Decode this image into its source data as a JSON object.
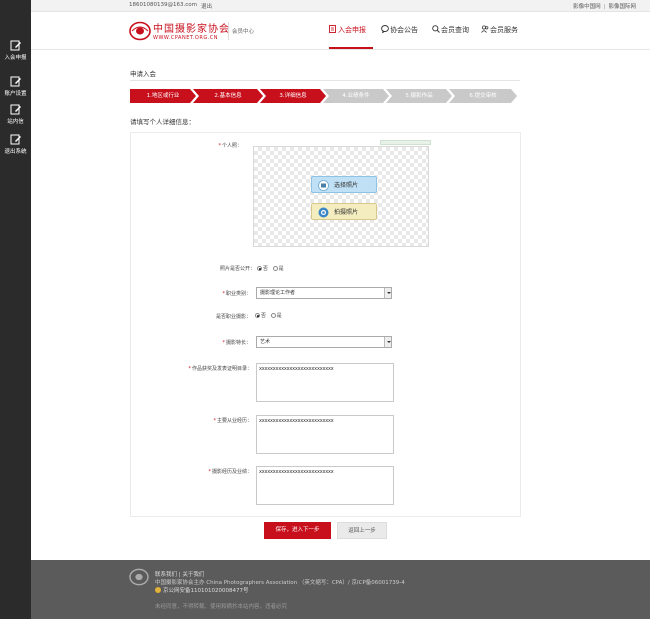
{
  "sidebar": {
    "items": [
      {
        "label": "入会申报",
        "icon": "edit-doc-icon"
      },
      {
        "label": "账户设置",
        "icon": "edit-doc-icon"
      },
      {
        "label": "站内信",
        "icon": "edit-doc-icon"
      },
      {
        "label": "退出系统",
        "icon": "edit-doc-icon"
      }
    ]
  },
  "topbar": {
    "email": "18601080139@163.com",
    "logout": "退出",
    "link1": "影像中国网",
    "separator": "|",
    "link2": "影像国际网"
  },
  "header": {
    "logo_cn": "中国摄影家协会",
    "logo_en": "WWW.CPANET.ORG.CN",
    "member_center": "会员中心",
    "nav": [
      {
        "label": "入会申报",
        "icon": "doc-edit-icon",
        "active": true
      },
      {
        "label": "协会公告",
        "icon": "chat-bubble-icon",
        "active": false
      },
      {
        "label": "会员查询",
        "icon": "search-icon",
        "active": false
      },
      {
        "label": "会员服务",
        "icon": "users-icon",
        "active": false
      }
    ]
  },
  "main": {
    "page_title": "申请入会",
    "steps": [
      {
        "label": "1.地区或行业",
        "state": "done"
      },
      {
        "label": "2.基本信息",
        "state": "done"
      },
      {
        "label": "3.详细信息",
        "state": "current"
      },
      {
        "label": "4.业绩条件",
        "state": "todo"
      },
      {
        "label": "5.摄影作品",
        "state": "todo"
      },
      {
        "label": "6.提交审核",
        "state": "todo"
      }
    ],
    "section_label": "请填写个人详细信息："
  },
  "form": {
    "req_mark": "*",
    "photo_label": "个人照：",
    "select_photo": "选择照片",
    "take_photo": "拍摄照片",
    "photo_public_label": "照片是否公开：",
    "radio_no": "否",
    "radio_yes": "是",
    "occupation_label": "职业类别：",
    "occupation_value": "摄影理论工作者",
    "pro_photo_label": "是否职业摄影：",
    "specialty_label": "摄影特长：",
    "specialty_value": "艺术",
    "awards_label": "作品获奖及发表证明目录：",
    "awards_value": "xxxxxxxxxxxxxxxxxxxxxxxxxxx",
    "career_label": "主要从业经历：",
    "career_value": "xxxxxxxxxxxxxxxxxxxxxxxxxxx",
    "photo_exp_label": "摄影经历及业绩：",
    "photo_exp_value": "xxxxxxxxxxxxxxxxxxxxxxxxxxx",
    "save_button": "保存，进入下一步",
    "prev_button": "返回上一步"
  },
  "footer": {
    "line1": "联系我们 | 关于我们",
    "line2": "中国摄影家协会主办 China Photographers Association （英文缩写：CPA）/ 京ICP备06001739-4",
    "line3": "京公网安备110101020008477号",
    "line4": "未经同意，不得转载、使用和摘抄本站内容，违者必究"
  },
  "colors": {
    "brand_red": "#c8101d",
    "sidebar_bg": "#2b2b2b",
    "footer_bg": "#5b5b5b",
    "step_todo": "#c9c9c9"
  }
}
